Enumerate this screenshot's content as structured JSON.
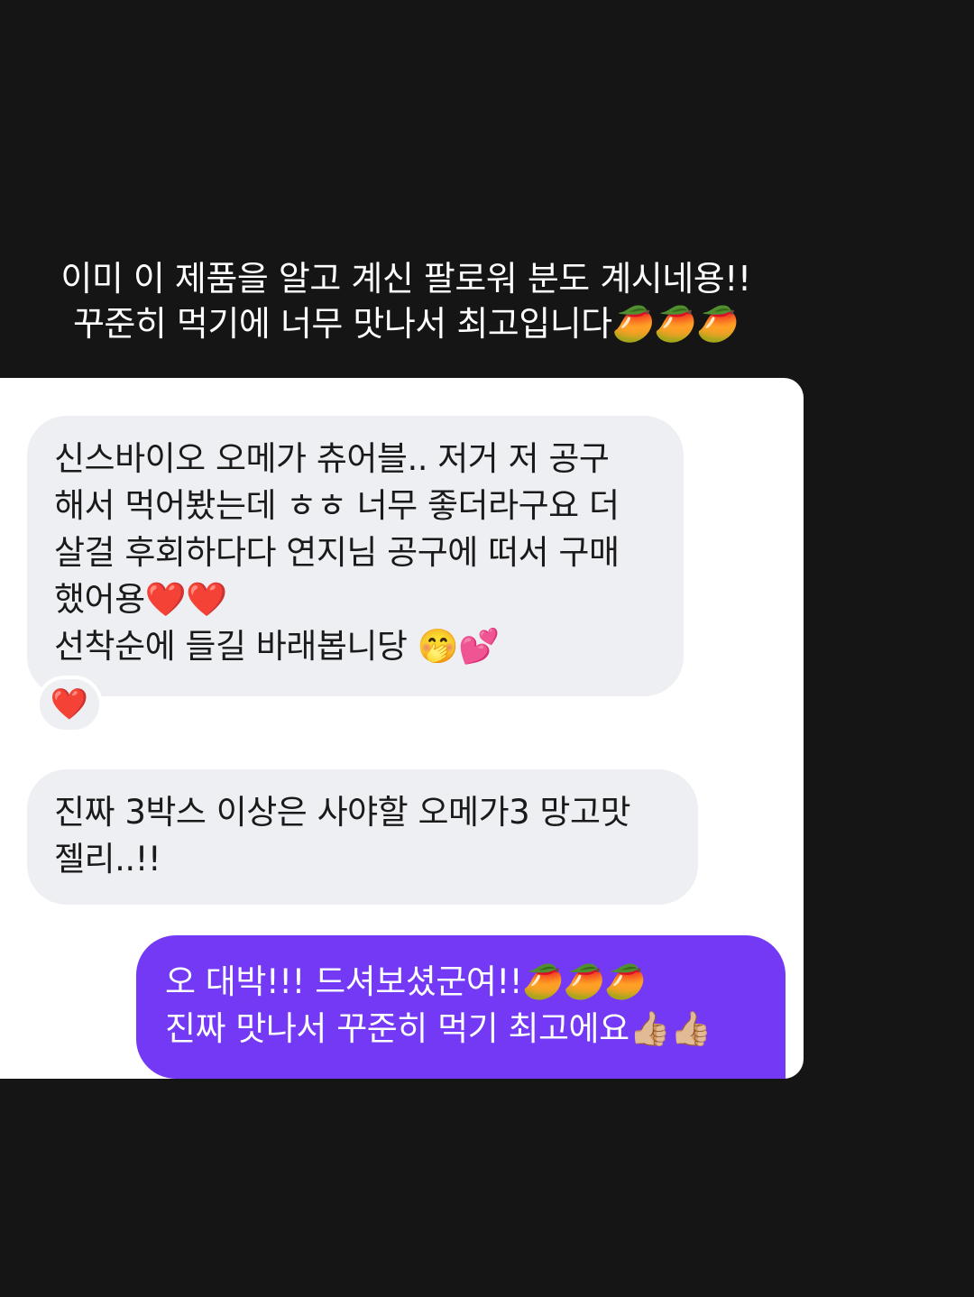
{
  "caption": {
    "line1": "이미 이 제품을 알고 계신 팔로워 분도 계시네용!!",
    "line2": "꾸준히 먹기에 너무 맛나서 최고입니다🥭🥭🥭"
  },
  "messages": {
    "incoming_1": {
      "line1": "신스바이오 오메가 츄어블.. 저거 저 공구",
      "line2": "해서 먹어봤는데 ㅎㅎ 너무 좋더라구요 더",
      "line3": "살걸 후회하다다 연지님 공구에 떠서 구매",
      "line4": "했어용❤️❤️",
      "line5": "선착순에 들길 바래봅니당 🤭💕"
    },
    "reaction": "❤️",
    "incoming_2": {
      "line1": "진짜 3박스 이상은 사야할 오메가3 망고맛",
      "line2": "젤리..!!"
    },
    "outgoing_1": {
      "line1": "오 대박!!! 드셔보셨군여!!🥭🥭🥭",
      "line2": "진짜 맛나서 꾸준히 먹기 최고에요👍🏼👍🏼"
    }
  },
  "colors": {
    "background": "#151516",
    "incoming_bubble": "#eeeff3",
    "outgoing_bubble": "#7339f5",
    "reaction_heart": "#e0202c"
  }
}
